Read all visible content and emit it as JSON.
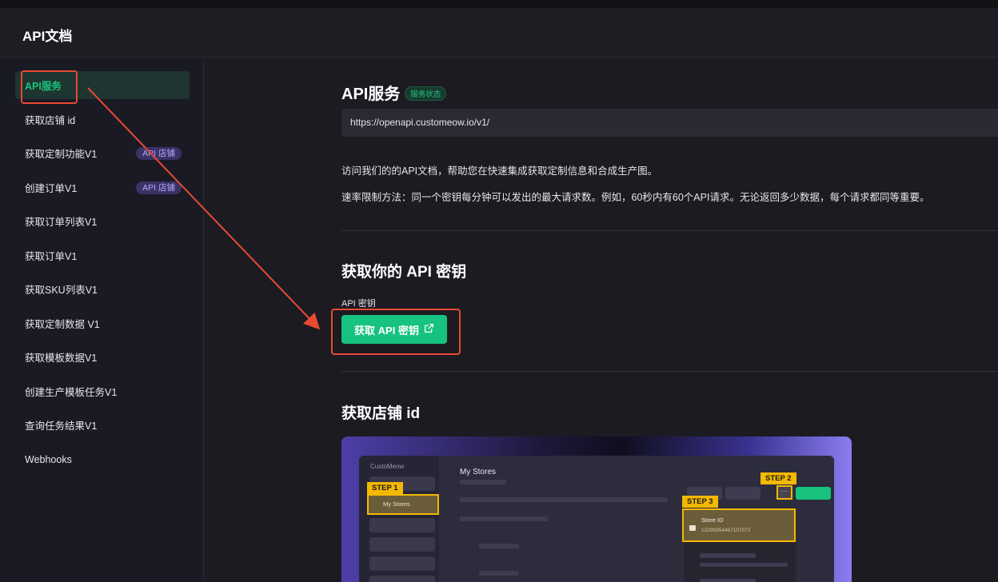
{
  "header": {
    "title": "API文档"
  },
  "sidebar": {
    "items": [
      {
        "label": "API服务",
        "badge": "",
        "active": true
      },
      {
        "label": "获取店铺 id",
        "badge": ""
      },
      {
        "label": "获取定制功能V1",
        "badge": "API 店铺"
      },
      {
        "label": "创建订单V1",
        "badge": "API 店铺"
      },
      {
        "label": "获取订单列表V1",
        "badge": ""
      },
      {
        "label": "获取订单V1",
        "badge": ""
      },
      {
        "label": "获取SKU列表V1",
        "badge": ""
      },
      {
        "label": "获取定制数据 V1",
        "badge": ""
      },
      {
        "label": "获取模板数据V1",
        "badge": ""
      },
      {
        "label": "创建生产模板任务V1",
        "badge": ""
      },
      {
        "label": "查询任务结果V1",
        "badge": ""
      },
      {
        "label": "Webhooks",
        "badge": ""
      }
    ]
  },
  "main": {
    "api_service": {
      "title": "API服务",
      "status_badge": "服务状态",
      "base_url": "https://openapi.customeow.io/v1/",
      "intro": "访问我们的的API文档，帮助您在快速集成获取定制信息和合成生产图。",
      "rate_limit": "速率限制方法：同一个密钥每分钟可以发出的最大请求数。例如，60秒内有60个API请求。无论返回多少数据，每个请求都同等重要。"
    },
    "get_key": {
      "title": "获取你的 API 密钥",
      "label": "API 密钥",
      "button_label": "获取 API 密钥"
    },
    "store_id": {
      "title": "获取店铺 id",
      "illustration": {
        "logo": "CustoMeow",
        "page_title": "My Stores",
        "menu_item": "My Stores",
        "step1": "STEP 1",
        "step2": "STEP 2",
        "step3": "STEP 3",
        "more": "···",
        "store_id_label": "Store ID",
        "store_id_value": "1229935446710707​2"
      }
    }
  },
  "colors": {
    "accent_green": "#16c27f",
    "annotation_red": "#e84a31",
    "step_yellow": "#f3b800",
    "badge_purple": "#3b3266"
  }
}
